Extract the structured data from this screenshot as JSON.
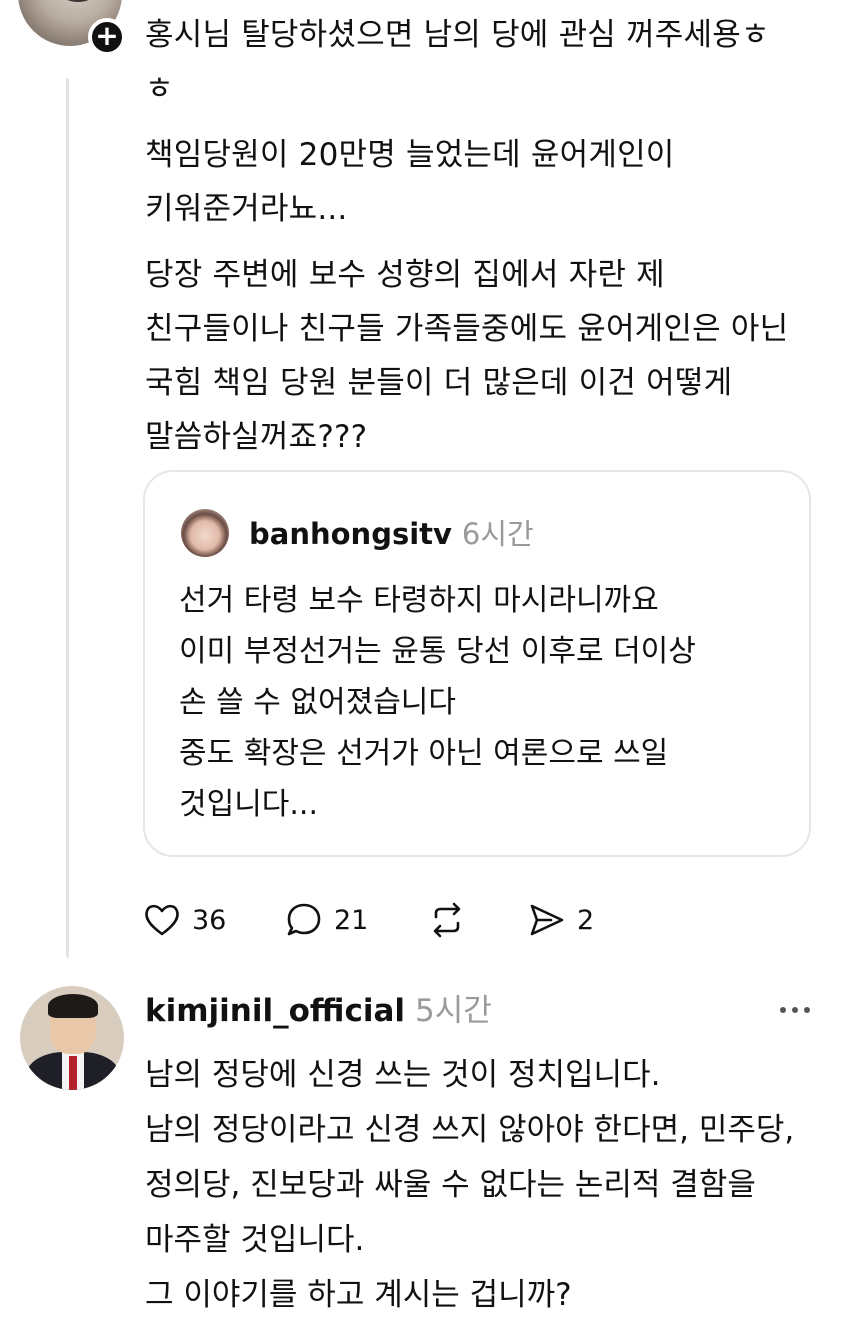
{
  "post": {
    "follow_symbol": "+",
    "paragraphs": [
      [
        "홍시님 탈당하셨으면 남의 당에 관심 꺼주세용ㅎ",
        "ㅎ"
      ],
      [
        "책임당원이 20만명 늘었는데 윤어게인이",
        "키워준거라뇨..."
      ],
      [
        "당장 주변에 보수 성향의 집에서 자란 제",
        "친구들이나 친구들 가족들중에도 윤어게인은 아닌",
        "국힘 책임 당원 분들이 더 많은데 이건 어떻게",
        "말씀하실꺼죠???"
      ]
    ],
    "quote": {
      "username": "banhongsitv",
      "time": "6시간",
      "lines": [
        "선거 타령 보수 타령하지 마시라니까요",
        "이미 부정선거는 윤통 당선 이후로 더이상",
        "손 쓸 수 없어졌습니다",
        "중도 확장은 선거가 아닌 여론으로 쓰일",
        "것입니다..."
      ]
    },
    "actions": {
      "like_count": "36",
      "reply_count": "21",
      "share_count": "2"
    }
  },
  "reply": {
    "username": "kimjinil_official",
    "time": "5시간",
    "lines": [
      "남의 정당에 신경 쓰는 것이 정치입니다.",
      "남의 정당이라고 신경 쓰지 않아야 한다면, 민주당,",
      "정의당, 진보당과 싸울 수 없다는 논리적 결함을",
      "마주할 것입니다.",
      "그 이야기를 하고 계시는 겁니까?"
    ]
  },
  "icons": {
    "like": "heart-icon",
    "reply": "speech-bubble-icon",
    "repost": "repost-arrows-icon",
    "share": "send-icon",
    "more": "more-dots-icon"
  }
}
